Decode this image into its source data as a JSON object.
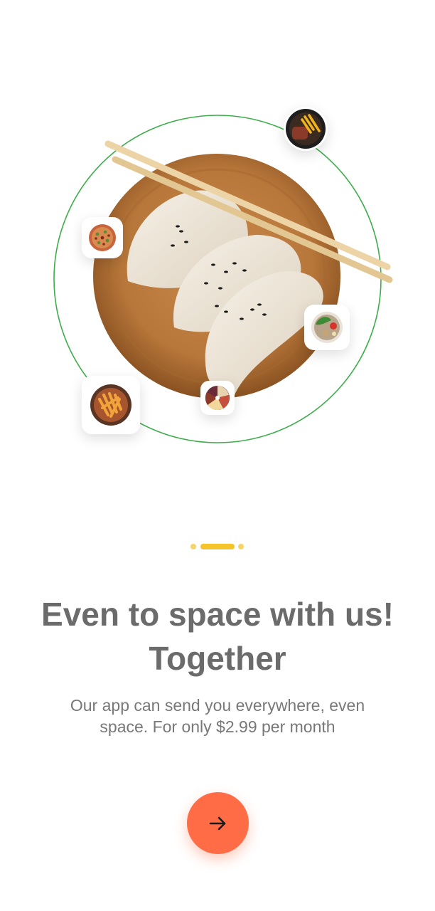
{
  "onboarding": {
    "title_line1": "Even to space with us!",
    "title_line2": "Together",
    "description_line1": "Our app can send you everywhere, even",
    "description_line2": "space. For only $2.99 per month",
    "pager": {
      "total": 3,
      "active": 2
    },
    "next_button_icon": "arrow-right-icon"
  },
  "illustration": {
    "main_dish": "dumplings-plate-image",
    "accent_ring_color": "#3dae4a",
    "thumbnails": [
      "steak-fries-icon",
      "pizza-icon",
      "salad-bowl-icon",
      "fries-basket-icon",
      "pie-slices-icon"
    ]
  },
  "colors": {
    "accent": "#ff6c45",
    "indicator_active": "#f5c42c",
    "indicator_inactive": "#f7d46a",
    "text": "#6b6b6b"
  }
}
